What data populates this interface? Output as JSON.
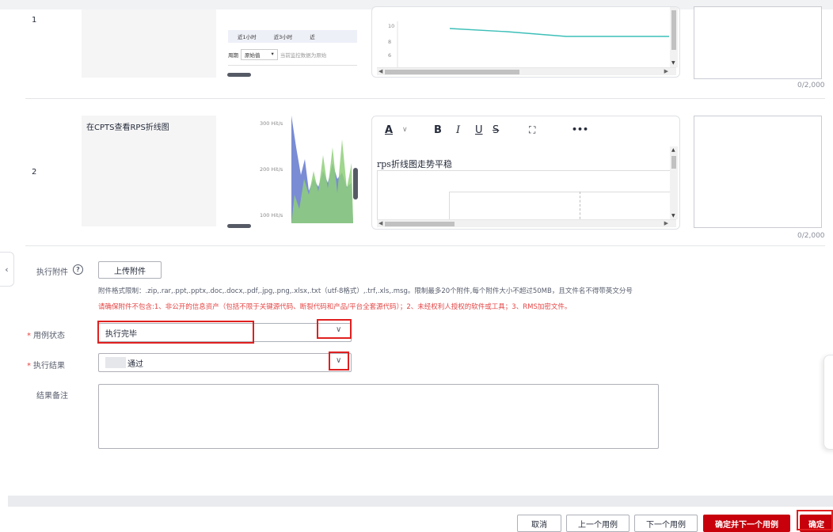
{
  "steps": [
    {
      "number": "1",
      "description": "",
      "thumb_tabs": [
        "近1小时",
        "近3小时",
        "近"
      ],
      "thumb_period_label": "周期",
      "thumb_period_value": "原始值",
      "thumb_hint": "当前监控数据为原始",
      "editor_axis_ticks": [
        "10",
        "8",
        "6"
      ],
      "counter": "0/2,000"
    },
    {
      "number": "2",
      "description": "在CPTS查看RPS折线图",
      "thumb_axis": [
        "300 Hit/s",
        "200 Hit/s",
        "100 Hit/s"
      ],
      "editor_text": "rps折线图走势平稳",
      "toolbar": [
        "A",
        "∨",
        "B",
        "I",
        "U",
        "S",
        "⛶",
        "•••"
      ],
      "counter": "0/2,000"
    }
  ],
  "attachment": {
    "label": "执行附件",
    "upload_label": "上传附件",
    "format_hint": "附件格式限制：.zip,.rar,.ppt,.pptx,.doc,.docx,.pdf,.jpg,.png,.xlsx,.txt（utf-8格式）,.trf,.xls,.msg。限制最多20个附件,每个附件大小不超过50MB，且文件名不得带英文分号",
    "warning": "请确保附件不包含:1、非公开的信息资产（包括不限于关键源代码、断裂代码和产品/平台全套源代码）；2、未经权利人授权的软件或工具；3、RMS加密文件。"
  },
  "case_status": {
    "label": "用例状态",
    "value": "执行完毕"
  },
  "exec_result": {
    "label": "执行结果",
    "value": "通过"
  },
  "remark": {
    "label": "结果备注",
    "value": ""
  },
  "footer": {
    "cancel": "取消",
    "prev": "上一个用例",
    "next": "下一个用例",
    "confirm_next": "确定并下一个用例",
    "confirm": "确定"
  },
  "colors": {
    "primary": "#c7000b",
    "required": "#e54545",
    "highlight_box": "#e02020",
    "chart_teal": "#3dbfb8",
    "chart_blue": "#6b7fcf",
    "chart_green": "#8fcf7a"
  },
  "icons": {
    "help": "question-circle-icon",
    "collapse": "chevron-left-icon",
    "dropdown": "chevron-down-icon"
  }
}
